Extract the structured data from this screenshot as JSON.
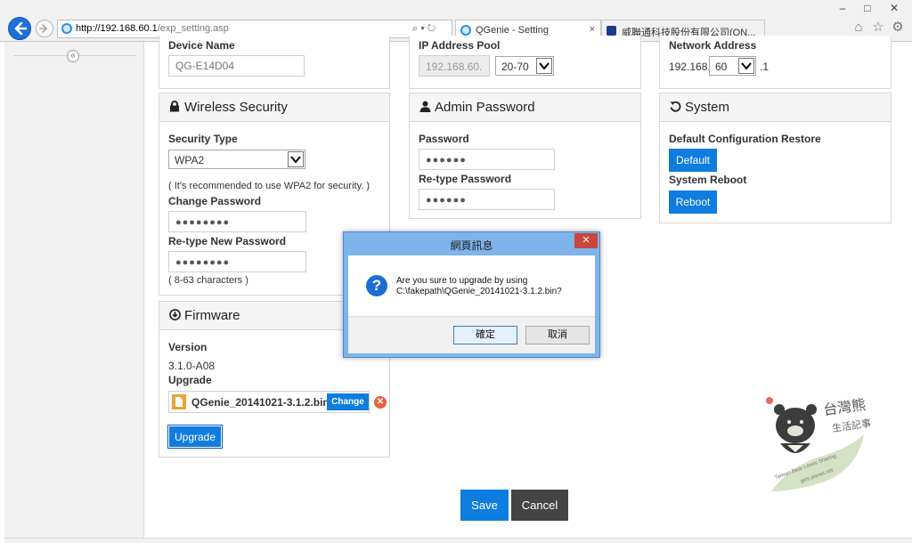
{
  "browser": {
    "url_host": "http://192.168.60.1",
    "url_path": "/exp_setting.asp",
    "address_tools": "⌕ ▾ ↻",
    "tabs": [
      {
        "label": "QGenie - Setting",
        "close": "×"
      },
      {
        "label": "威聯通科技股份有限公司(QN..."
      }
    ],
    "window_controls": {
      "minimize": "–",
      "maximize": "□",
      "close": "✕"
    }
  },
  "device": {
    "name_label": "Device Name",
    "name_placeholder": "QG-E14D04"
  },
  "ip_pool": {
    "label": "IP Address Pool",
    "prefix_value": "192.168.60.",
    "range_value": "20-70"
  },
  "network": {
    "label": "Network Address",
    "prefix": "192.168.",
    "value": "60",
    "suffix": ".1"
  },
  "wireless_security": {
    "title": "Wireless Security",
    "icon": "lock-icon",
    "security_type_label": "Security Type",
    "security_type_value": "WPA2",
    "recommendation_note": "( It's recommended to use WPA2 for security. )",
    "change_password_label": "Change Password",
    "change_password_value": "●●●●●●●●",
    "retype_label": "Re-type New Password",
    "retype_value": "●●●●●●●●",
    "length_note": "( 8-63 characters )"
  },
  "admin_password": {
    "title": "Admin Password",
    "icon": "user-icon",
    "password_label": "Password",
    "password_value": "●●●●●●",
    "retype_label": "Re-type Password",
    "retype_value": "●●●●●●"
  },
  "system": {
    "title": "System",
    "icon": "reset-icon",
    "restore_label": "Default Configuration Restore",
    "default_button": "Default",
    "reboot_label": "System Reboot",
    "reboot_button": "Reboot"
  },
  "firmware": {
    "title": "Firmware",
    "icon": "download-circle-icon",
    "version_label": "Version",
    "version_value": "3.1.0-A08",
    "upgrade_label": "Upgrade",
    "file_name": "QGenie_20141021-3.1.2.bin",
    "change_button": "Change",
    "upgrade_button": "Upgrade"
  },
  "actions": {
    "save": "Save",
    "cancel": "Cancel"
  },
  "dialog": {
    "title": "網頁訊息",
    "message_line1": "Are you sure to upgrade by using",
    "message_line2": "C:\\fakepath\\QGenie_20141021-3.1.2.bin?",
    "ok_button": "確定",
    "cancel_button": "取消",
    "close": "✕"
  },
  "watermark": {
    "text_top": "台灣熊",
    "text_mid": "生活記事",
    "text_arc1": "Taiwan Bear Loves Sharing",
    "text_arc2": "girls.pixnet.net"
  },
  "colors": {
    "accent": "#0f7ddf",
    "cancel_button": "#444444",
    "dialog_frame": "#7eb4ea",
    "dialog_close": "#c9473c",
    "remove_icon": "#e8643d",
    "file_icon": "#e9a23b"
  }
}
